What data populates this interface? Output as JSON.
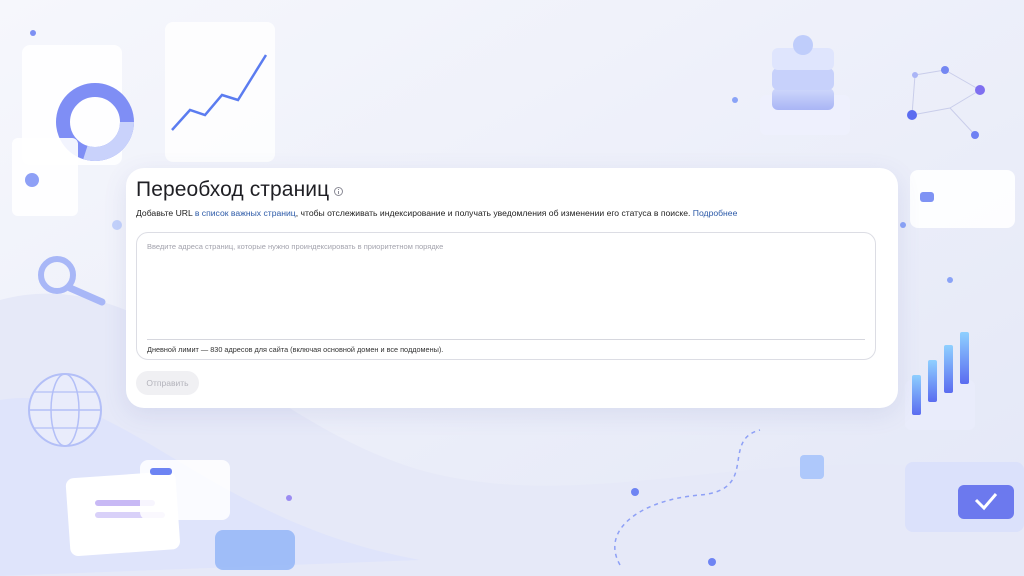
{
  "page": {
    "title": "Переобход страниц",
    "description_prefix": "Добавьте URL ",
    "description_link": "в список важных страниц",
    "description_middle": ", чтобы отслеживать индексирование и получать уведомления об изменении его статуса в поиске. ",
    "description_more_link": "Подробнее"
  },
  "url_input": {
    "placeholder": "Введите адреса страниц, которые нужно проиндексировать в приоритетном порядке",
    "value": ""
  },
  "limit_note": "Дневной лимит — 830 адресов для сайта (включая основной домен и все поддомены).",
  "submit_button": {
    "label": "Отправить",
    "state": "disabled"
  },
  "colors": {
    "background": "#eef0f8",
    "accent_blue": "#5b7cf0",
    "accent_purple": "#9b8cf2",
    "link": "#2c5aa8"
  }
}
